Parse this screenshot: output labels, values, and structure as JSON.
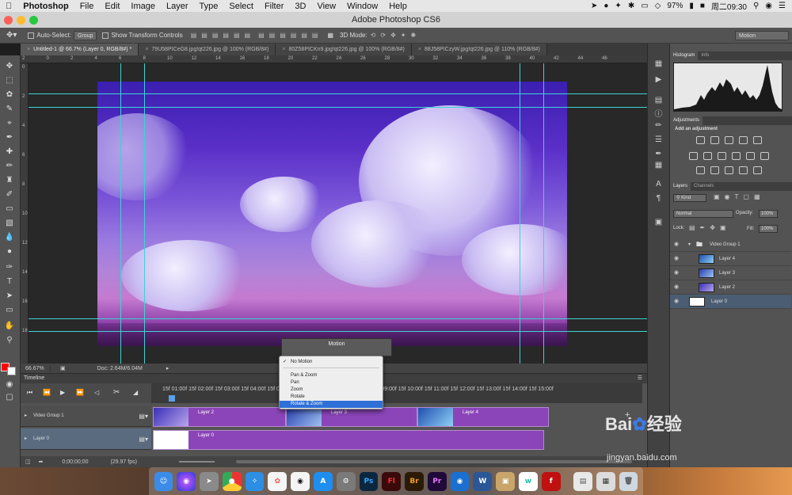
{
  "menubar": {
    "apple": "",
    "app": "Photoshop",
    "items": [
      "File",
      "Edit",
      "Image",
      "Layer",
      "Type",
      "Select",
      "Filter",
      "3D",
      "View",
      "Window",
      "Help"
    ],
    "battery": "97%",
    "clock": "周二09:30"
  },
  "window": {
    "title": "Adobe Photoshop CS6"
  },
  "options": {
    "auto_select_label": "Auto-Select:",
    "auto_select_value": "Group",
    "show_transform": "Show Transform Controls",
    "mode_3d": "3D Mode:",
    "workspace": "Motion"
  },
  "tabs": [
    {
      "label": "Untitled-1 @ 66.7% (Layer 0, RGB/8#) *"
    },
    {
      "label": "79U58PICeG8.jpg!qt226.jpg @ 100% (RGB/8#)"
    },
    {
      "label": "80Z58PICKn9.jpg!qt226.jpg @ 100% (RGB/8#)"
    },
    {
      "label": "88J58PICzyW.jpg!qt226.jpg @ 110% (RGB/8#)"
    }
  ],
  "ruler": {
    "h": [
      "2",
      "0",
      "2",
      "4",
      "6",
      "8",
      "10",
      "12",
      "14",
      "16",
      "18",
      "20",
      "22",
      "24",
      "26",
      "28",
      "30",
      "32",
      "34",
      "36",
      "38",
      "40",
      "42",
      "44",
      "46"
    ],
    "v": [
      "0",
      "2",
      "4",
      "6",
      "8",
      "10",
      "12",
      "14",
      "16",
      "18"
    ]
  },
  "status": {
    "zoom": "66.67%",
    "doc": "Doc: 2.64M/6.04M"
  },
  "panels": {
    "histogram_tab": "Histogram",
    "info_tab": "Info",
    "adjustments_tab": "Adjustments",
    "add_adjustment": "Add an adjustment",
    "layers_tab": "Layers",
    "channels_tab": "Channels",
    "kind": "Kind",
    "blend": "Normal",
    "opacity_label": "Opacity:",
    "opacity": "100%",
    "lock_label": "Lock:",
    "fill_label": "Fill:",
    "fill": "100%",
    "layers": [
      {
        "name": "Video Group 1"
      },
      {
        "name": "Layer 4"
      },
      {
        "name": "Layer 3"
      },
      {
        "name": "Layer 2"
      },
      {
        "name": "Layer 0"
      }
    ]
  },
  "timeline": {
    "title": "Timeline",
    "ruler": "15f 01:00f 15f 02:00f 15f 03:00f 15f 04:00f 15f 05:00f 15f 06:00f 15f 07:00f 15f 08:00f 15f 09:00f 15f 10:00f 15f 11:00f 15f 12:00f 15f 13:00f 15f 14:00f 15f 15:00f",
    "tracks": [
      {
        "name": "Video Group 1"
      },
      {
        "name": "Layer 0"
      }
    ],
    "clips": {
      "layer2": "Layer 2",
      "layer3": "Layer 3",
      "layer4": "Layer 4",
      "layer0": "Layer 0"
    },
    "timecode": "0;00;00;00",
    "fps": "(29.97 fps)"
  },
  "motion": {
    "title": "Motion",
    "options": [
      "No Motion",
      "Pan & Zoom",
      "Pan",
      "Zoom",
      "Rotate",
      "Rotate & Zoom"
    ],
    "checked": "No Motion",
    "highlighted": "Rotate & Zoom"
  },
  "dock": {
    "apps": [
      "Finder",
      "Siri",
      "Launchpad",
      "Chrome",
      "Safari",
      "Photos",
      "QQ",
      "App Store",
      "System Preferences",
      "Ps",
      "Fl",
      "Br",
      "Pr",
      "Edge",
      "W",
      "Archive",
      "Wunderlist",
      "Flash",
      "Preview",
      "Photo Browser",
      "Trash"
    ]
  },
  "watermark": {
    "logo": "Baiåº¦经验",
    "url": "jingyan.baidu.com"
  }
}
